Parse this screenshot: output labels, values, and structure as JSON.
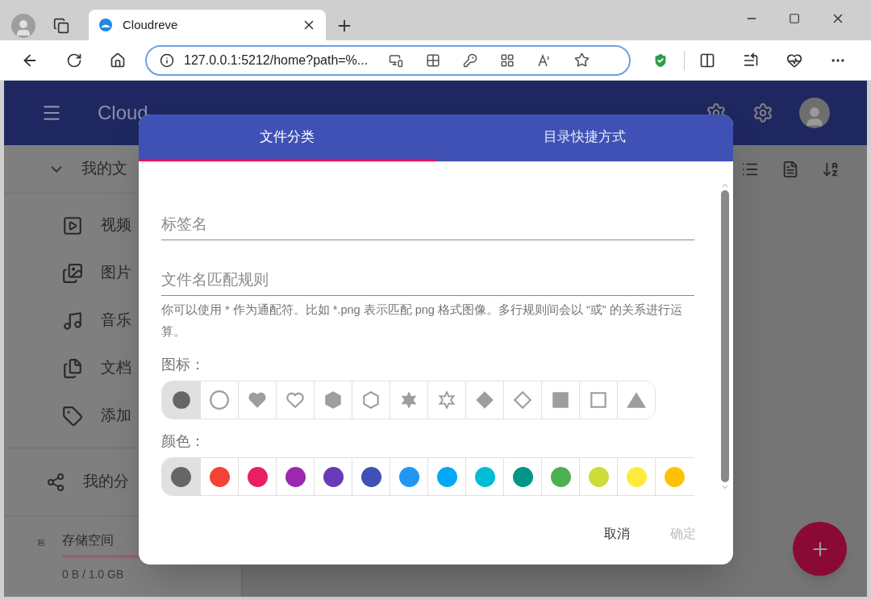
{
  "browser": {
    "tab_title": "Cloudreve",
    "url": "127.0.0.1:5212/home?path=%..."
  },
  "app_bar": {
    "title": "Cloud"
  },
  "sidebar": {
    "folder": "我的文",
    "items": [
      {
        "kind": "video",
        "label": "视频"
      },
      {
        "kind": "image",
        "label": "图片"
      },
      {
        "kind": "music",
        "label": "音乐"
      },
      {
        "kind": "doc",
        "label": "文档"
      },
      {
        "kind": "tag",
        "label": "添加"
      }
    ],
    "share": "我的分",
    "storage": {
      "label": "存储空间",
      "usage": "0 B / 1.0 GB"
    }
  },
  "dialog": {
    "tabs": [
      {
        "label": "文件分类",
        "selected": true
      },
      {
        "label": "目录快捷方式",
        "selected": false
      }
    ],
    "fields": [
      {
        "placeholder": "标签名"
      },
      {
        "placeholder": "文件名匹配规则"
      }
    ],
    "helper": "你可以使用 * 作为通配符。比如 *.png 表示匹配 png 格式图像。多行规则间会以 “或” 的关系进行运算。",
    "icon_label": "图标：",
    "icons": [
      {
        "kind": "circle",
        "selected": true
      },
      {
        "kind": "circle-outline",
        "selected": false
      },
      {
        "kind": "heart",
        "selected": false
      },
      {
        "kind": "heart-outline",
        "selected": false
      },
      {
        "kind": "hexagon",
        "selected": false
      },
      {
        "kind": "hexagon-outline",
        "selected": false
      },
      {
        "kind": "star",
        "selected": false
      },
      {
        "kind": "star-outline",
        "selected": false
      },
      {
        "kind": "diamond",
        "selected": false
      },
      {
        "kind": "diamond-outline",
        "selected": false
      },
      {
        "kind": "square",
        "selected": false
      },
      {
        "kind": "square-outline",
        "selected": false
      },
      {
        "kind": "triangle",
        "selected": false
      }
    ],
    "color_label": "颜色：",
    "colors": [
      {
        "color": "#666666",
        "selected": true
      },
      {
        "color": "#f44336",
        "selected": false
      },
      {
        "color": "#e91e63",
        "selected": false
      },
      {
        "color": "#9c27b0",
        "selected": false
      },
      {
        "color": "#673ab7",
        "selected": false
      },
      {
        "color": "#3f51b5",
        "selected": false
      },
      {
        "color": "#2196f3",
        "selected": false
      },
      {
        "color": "#03a9f4",
        "selected": false
      },
      {
        "color": "#00bcd4",
        "selected": false
      },
      {
        "color": "#009688",
        "selected": false
      },
      {
        "color": "#4caf50",
        "selected": false
      },
      {
        "color": "#cddc39",
        "selected": false
      },
      {
        "color": "#ffeb3b",
        "selected": false
      },
      {
        "color": "#ffc107",
        "selected": false
      }
    ],
    "actions": [
      {
        "label": "取消",
        "disabled": false
      },
      {
        "label": "确定",
        "disabled": true
      }
    ]
  }
}
